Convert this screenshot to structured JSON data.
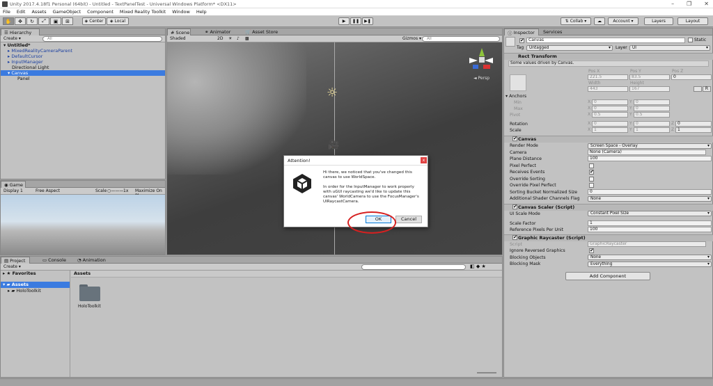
{
  "window": {
    "title": "Unity 2017.4.18f1 Personal (64bit) - Untitled - TextPanelTest - Universal Windows Platform* <DX11>",
    "minimize": "–",
    "maximize": "❐",
    "close": "✕"
  },
  "menu": [
    "File",
    "Edit",
    "Assets",
    "GameObject",
    "Component",
    "Mixed Reality Toolkit",
    "Window",
    "Help"
  ],
  "toolbar": {
    "center": "Center",
    "local": "Local",
    "collab": "Collab ▾",
    "account": "Account ▾",
    "layers": "Layers",
    "layout": "Layout"
  },
  "hierarchy": {
    "tab": "Hierarchy",
    "create": "Create ▾",
    "search_placeholder": "All",
    "scene": "Untitled*",
    "items": [
      "MixedRealityCameraParent",
      "DefaultCursor",
      "InputManager",
      "Directional Light",
      "Canvas",
      "Panel"
    ]
  },
  "scene": {
    "tabs": [
      "Scene",
      "Animator",
      "Asset Store"
    ],
    "shading": "Shaded",
    "mode": "2D",
    "gizmos": "Gizmos ▾",
    "search_placeholder": "All",
    "persp": "◄ Persp"
  },
  "game": {
    "tab": "Game",
    "display": "Display 1",
    "aspect": "Free Aspect",
    "scale_label": "Scale",
    "scale_value": "1x",
    "maximize": "Maximize On Pl"
  },
  "dialog": {
    "title": "Attention!",
    "para1": "Hi there, we noticed that you've changed this canvas to use WorldSpace.",
    "para2": "In order for the InputManager to work properly with uGUI raycasting we'd like to update this canvas' WorldCamera to use the FocusManager's UIRaycastCamera.",
    "ok": "OK",
    "cancel": "Cancel",
    "close": "x"
  },
  "project": {
    "tabs": [
      "Project",
      "Console",
      "Animation"
    ],
    "create": "Create ▾",
    "favorites": "Favorites",
    "assets": "Assets",
    "holotoolkit": "HoloToolkit",
    "breadcrumb": "Assets",
    "folder_label": "HoloToolkit"
  },
  "inspector": {
    "tabs": [
      "Inspector",
      "Services"
    ],
    "name": "Canvas",
    "static": "Static",
    "tag_label": "Tag",
    "tag": "Untagged",
    "layer_label": "Layer",
    "layer": "UI",
    "rect": {
      "header": "Rect Transform",
      "note": "Some values driven by Canvas.",
      "pos_x_label": "Pos X",
      "pos_y_label": "Pos Y",
      "pos_z_label": "Pos Z",
      "pos_x": "221.5",
      "pos_y": "83.5",
      "pos_z": "0",
      "width_label": "Width",
      "height_label": "Height",
      "width": "443",
      "height": "167",
      "anchors": "Anchors",
      "min": "Min",
      "max": "Max",
      "pivot": "Pivot",
      "min_x": "0",
      "min_y": "0",
      "max_x": "0",
      "max_y": "0",
      "pivot_x": "0.5",
      "pivot_y": "0.5",
      "rotation": "Rotation",
      "rot_x": "0",
      "rot_y": "0",
      "rot_z": "0",
      "scale": "Scale",
      "sc_x": "1",
      "sc_y": "1",
      "sc_z": "1",
      "x": "X",
      "y": "Y",
      "z": "Z",
      "r_btn": "R"
    },
    "canvas": {
      "header": "Canvas",
      "render_mode_label": "Render Mode",
      "render_mode": "Screen Space - Overlay",
      "camera_label": "Camera",
      "camera": "None (Camera)",
      "plane_label": "Plane Distance",
      "plane": "100",
      "pixel_perfect": "Pixel Perfect",
      "receives_events": "Receives Events",
      "override_sorting": "Override Sorting",
      "override_pp": "Override Pixel Perfect",
      "sort_bucket_label": "Sorting Bucket Normalized Size",
      "sort_bucket": "0",
      "shader_label": "Additional Shader Channels Flag",
      "shader": "None"
    },
    "scaler": {
      "header": "Canvas Scaler (Script)",
      "mode_label": "UI Scale Mode",
      "mode": "Constant Pixel Size",
      "factor_label": "Scale Factor",
      "factor": "1",
      "ref_label": "Reference Pixels Per Unit",
      "ref": "100"
    },
    "raycaster": {
      "header": "Graphic Raycaster (Script)",
      "script_label": "Script",
      "script": "GraphicRaycaster",
      "ignore_label": "Ignore Reversed Graphics",
      "blocking_label": "Blocking Objects",
      "blocking": "None",
      "mask_label": "Blocking Mask",
      "mask": "Everything"
    },
    "add_component": "Add Component"
  }
}
